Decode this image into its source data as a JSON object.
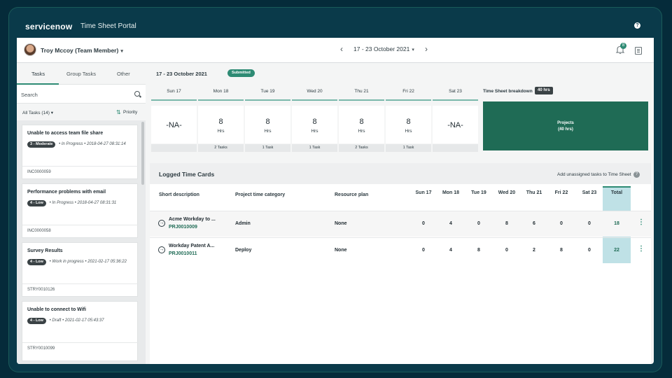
{
  "app": {
    "logo": "servicenow",
    "title": "Time Sheet Portal",
    "help_icon": "?"
  },
  "header": {
    "user": "Troy Mccoy (Team Member)",
    "user_caret": "▾",
    "week": "17 - 23 October 2021",
    "week_caret": "▾",
    "prev": "‹",
    "next": "›",
    "notification_count": "8"
  },
  "left": {
    "tabs": [
      "Tasks",
      "Group Tasks",
      "Other"
    ],
    "search_placeholder": "Search",
    "filter": "All Tasks (14)",
    "filter_caret": "▾",
    "sort_icon": "⇅",
    "sort": "Priority",
    "tasks": [
      {
        "title": "Unable to access team file share",
        "badge": "3 - Moderate",
        "status": "In Progress",
        "dot": "•",
        "date": "2018-04-27 08:31:14",
        "id": "INC0000059"
      },
      {
        "title": "Performance problems with email",
        "badge": "4 - Low",
        "status": "In Progress",
        "dot": "•",
        "date": "2018-04-27 08:31:31",
        "id": "INC0000058"
      },
      {
        "title": "Survey Results",
        "badge": "4 - Low",
        "status": "Work in progress",
        "dot": "•",
        "date": "2021-02-17 05:36:22",
        "id": "STRY0010126"
      },
      {
        "title": "Unable to connect to Wifi",
        "badge": "4 - Low",
        "status": "Draft",
        "dot": "•",
        "date": "2021-02-17 05:43:37",
        "id": "STRY0010099"
      }
    ]
  },
  "main": {
    "week_label": "17 - 23 October 2021",
    "status_badge": "Submitted",
    "days": [
      {
        "name": "Sun 17",
        "value": "-NA-",
        "unit": "",
        "foot": ""
      },
      {
        "name": "Mon 18",
        "value": "8",
        "unit": "Hrs",
        "foot": "2 Tasks"
      },
      {
        "name": "Tue 19",
        "value": "8",
        "unit": "Hrs",
        "foot": "1 Task"
      },
      {
        "name": "Wed 20",
        "value": "8",
        "unit": "Hrs",
        "foot": "1 Task"
      },
      {
        "name": "Thu 21",
        "value": "8",
        "unit": "Hrs",
        "foot": "2 Tasks"
      },
      {
        "name": "Fri 22",
        "value": "8",
        "unit": "Hrs",
        "foot": "1 Task"
      },
      {
        "name": "Sat 23",
        "value": "-NA-",
        "unit": "",
        "foot": ""
      }
    ],
    "breakdown": {
      "label": "Time Sheet breakdown",
      "hours": "40 hrs",
      "block_title": "Projects",
      "block_sub": "(40 hrs)"
    },
    "logged": {
      "title": "Logged Time Cards",
      "add_link": "Add unassigned tasks to Time Sheet",
      "add_help": "?",
      "columns": {
        "desc": "Short description",
        "cat": "Project time category",
        "plan": "Resource plan",
        "days": [
          "Sun 17",
          "Mon 18",
          "Tue 19",
          "Wed 20",
          "Thu 21",
          "Fri 22",
          "Sat 23"
        ],
        "total": "Total"
      },
      "rows": [
        {
          "desc": "Acme Workday to ...",
          "proj": "PRJ0010009",
          "cat": "Admin",
          "plan": "None",
          "vals": [
            "0",
            "4",
            "0",
            "8",
            "6",
            "0",
            "0"
          ],
          "total": "18",
          "go": "→",
          "kebab": "⋮"
        },
        {
          "desc": "Workday Patent A...",
          "proj": "PRJ0010011",
          "cat": "Deploy",
          "plan": "None",
          "vals": [
            "0",
            "4",
            "8",
            "0",
            "2",
            "8",
            "0"
          ],
          "total": "22",
          "go": "→",
          "kebab": "⋮"
        }
      ]
    }
  },
  "colors": {
    "accent": "#2e8b74",
    "breakdown": "#1f6b55",
    "total_col": "#bfe1e6",
    "frame": "#052b3a"
  }
}
